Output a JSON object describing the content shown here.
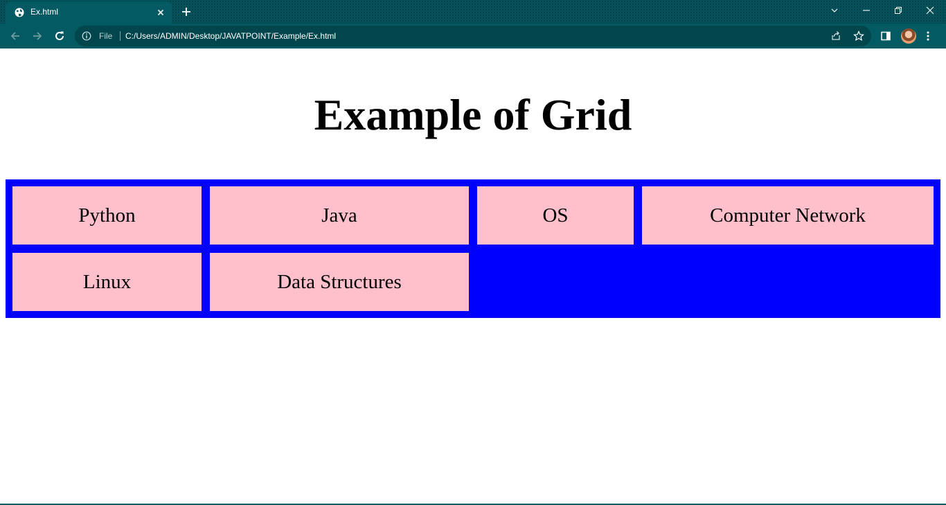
{
  "browser": {
    "tab_title": "Ex.html",
    "address_scheme": "File",
    "address_url": "C:/Users/ADMIN/Desktop/JAVATPOINT/Example/Ex.html",
    "theme_color": "#035a63"
  },
  "page": {
    "heading": "Example of Grid",
    "grid_background": "#0000ff",
    "item_background": "#ffc0cb",
    "items": [
      {
        "label": "Python"
      },
      {
        "label": "Java"
      },
      {
        "label": "OS"
      },
      {
        "label": "Computer Network"
      },
      {
        "label": "Linux"
      },
      {
        "label": "Data Structures"
      }
    ]
  }
}
